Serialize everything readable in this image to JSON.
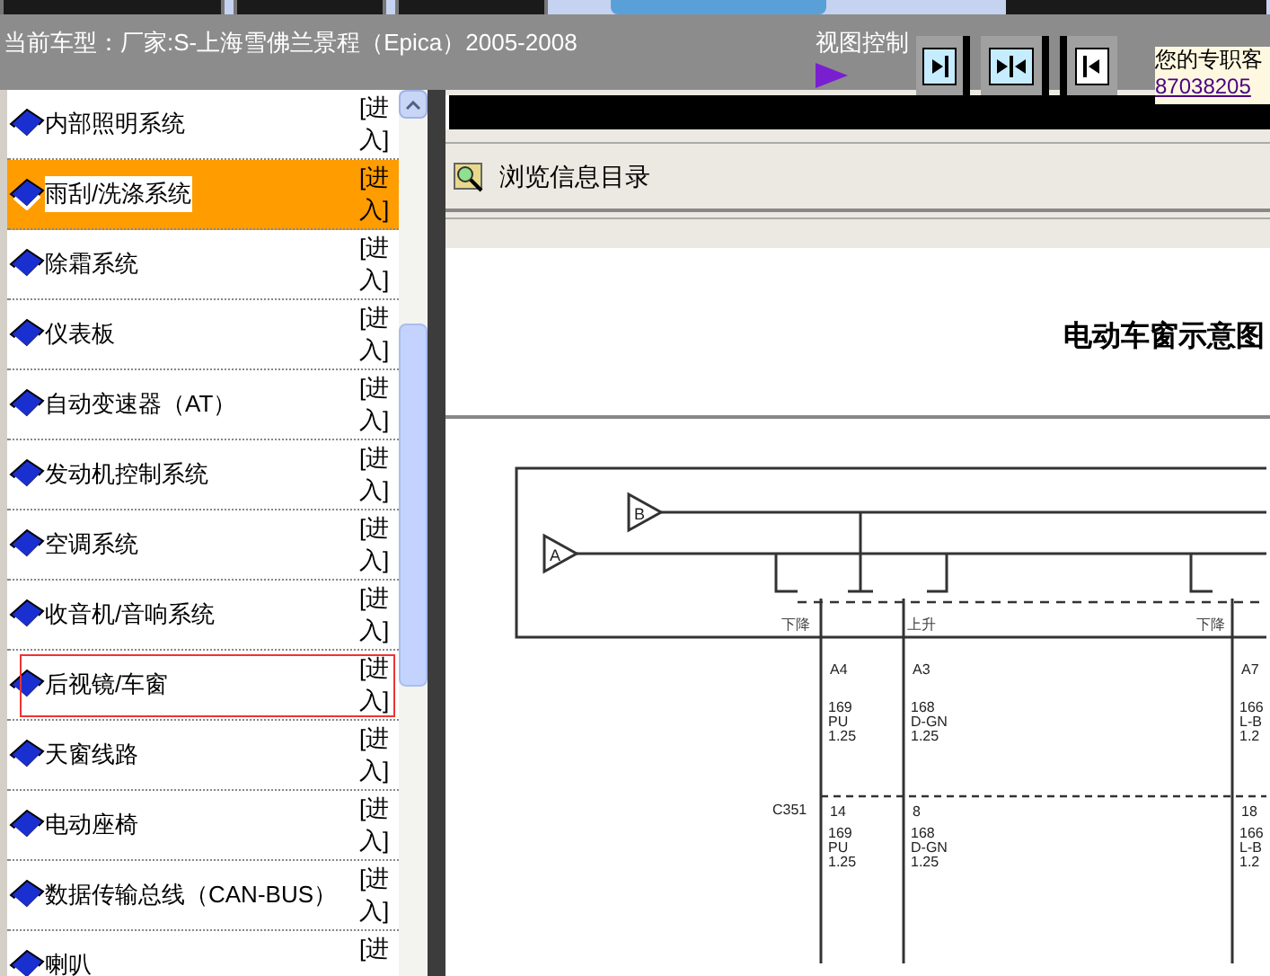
{
  "header": {
    "vehicle": "当前车型：厂家:S-上海雪佛兰景程（Epica）2005-2008",
    "view_control": "视图控制",
    "contact": "您的专职客",
    "phone": "87038205"
  },
  "systems": [
    {
      "name": "内部照明系统",
      "action": "[进入]",
      "selected": false,
      "focused": false
    },
    {
      "name": "雨刮/洗涤系统",
      "action": "[进入]",
      "selected": true,
      "focused": false
    },
    {
      "name": "除霜系统",
      "action": "[进入]",
      "selected": false,
      "focused": false
    },
    {
      "name": "仪表板",
      "action": "[进入]",
      "selected": false,
      "focused": false
    },
    {
      "name": "自动变速器（AT）",
      "action": "[进入]",
      "selected": false,
      "focused": false
    },
    {
      "name": "发动机控制系统",
      "action": "[进入]",
      "selected": false,
      "focused": false
    },
    {
      "name": "空调系统",
      "action": "[进入]",
      "selected": false,
      "focused": false
    },
    {
      "name": "收音机/音响系统",
      "action": "[进入]",
      "selected": false,
      "focused": false
    },
    {
      "name": "后视镜/车窗",
      "action": "[进入]",
      "selected": false,
      "focused": true
    },
    {
      "name": "天窗线路",
      "action": "[进入]",
      "selected": false,
      "focused": false
    },
    {
      "name": "电动座椅",
      "action": "[进入]",
      "selected": false,
      "focused": false
    },
    {
      "name": "数据传输总线（CAN-BUS）",
      "action": "[进入]",
      "selected": false,
      "focused": false
    },
    {
      "name": "喇叭",
      "action": "[进",
      "selected": false,
      "focused": false
    }
  ],
  "browser": {
    "toolbar_title": "浏览信息目录"
  },
  "diagram": {
    "title": "电动车窗示意图",
    "inputs": [
      "B",
      "A"
    ],
    "switches": [
      "下降",
      "上升",
      "下降"
    ],
    "connector": "C351",
    "wires": [
      {
        "pin": "A4",
        "connector_pin": "14",
        "upper": [
          "169",
          "PU",
          "1.25"
        ],
        "lower": [
          "169",
          "PU",
          "1.25"
        ]
      },
      {
        "pin": "A3",
        "connector_pin": "8",
        "upper": [
          "168",
          "D-GN",
          "1.25"
        ],
        "lower": [
          "168",
          "D-GN",
          "1.25"
        ]
      },
      {
        "pin": "A7",
        "connector_pin": "18",
        "upper": [
          "166",
          "L-B",
          "1.2"
        ],
        "lower": [
          "166",
          "L-B",
          "1.2"
        ]
      }
    ]
  }
}
